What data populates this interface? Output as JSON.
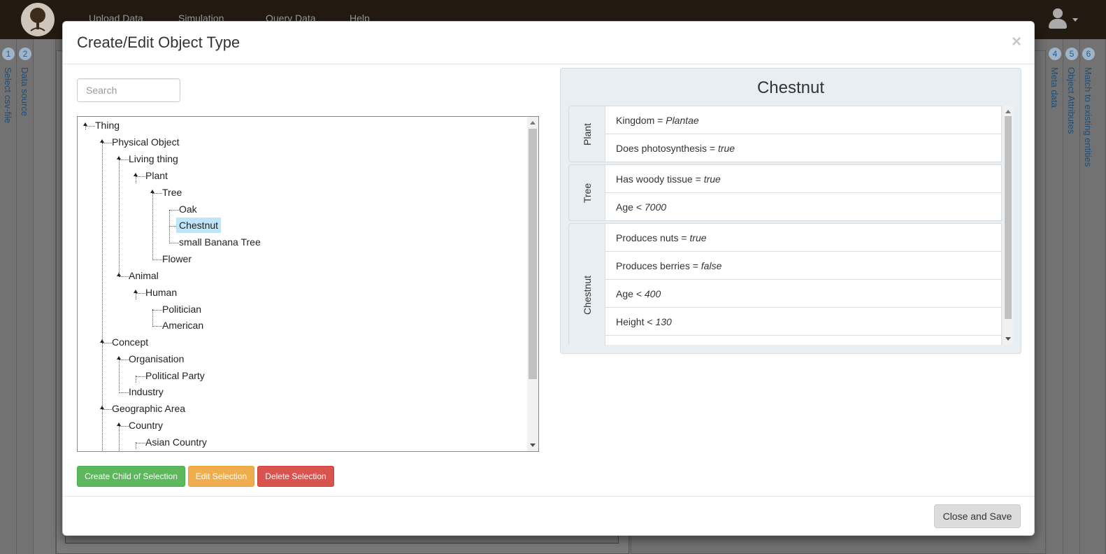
{
  "navbar": {
    "items": [
      "Upload Data",
      "Simulation",
      "Query Data",
      "Help"
    ]
  },
  "steps_left": [
    {
      "num": "1",
      "label": "Select csv-file"
    },
    {
      "num": "2",
      "label": "Data source"
    }
  ],
  "steps_right": [
    {
      "num": "4",
      "label": "Meta data"
    },
    {
      "num": "5",
      "label": "Object Attributes"
    },
    {
      "num": "6",
      "label": "Match to existing entities"
    }
  ],
  "modal": {
    "title": "Create/Edit Object Type",
    "close_symbol": "×",
    "search_placeholder": "Search",
    "tree": [
      "Thing",
      "Physical Object",
      "Living thing",
      "Plant",
      "Tree",
      "Oak",
      "Chestnut",
      "small Banana Tree",
      "Flower",
      "Animal",
      "Human",
      "Politician",
      "American",
      "Concept",
      "Organisation",
      "Political Party",
      "Industry",
      "Geographic Area",
      "Country",
      "Asian Country"
    ],
    "selected_node": "Chestnut",
    "buttons": {
      "create_child": "Create Child of Selection",
      "edit": "Edit Selection",
      "delete": "Delete Selection"
    },
    "detail": {
      "title": "Chestnut",
      "groups": [
        {
          "label": "Plant",
          "rows": [
            {
              "name": "Kingdom",
              "op": "=",
              "value": "Plantae"
            },
            {
              "name": "Does photosynthesis",
              "op": "=",
              "value": "true"
            }
          ]
        },
        {
          "label": "Tree",
          "rows": [
            {
              "name": "Has woody tissue",
              "op": "=",
              "value": "true"
            },
            {
              "name": "Age",
              "op": "<",
              "value": "7000"
            }
          ]
        },
        {
          "label": "Chestnut",
          "rows": [
            {
              "name": "Produces nuts",
              "op": "=",
              "value": "true"
            },
            {
              "name": "Produces berries",
              "op": "=",
              "value": "false"
            },
            {
              "name": "Age",
              "op": "<",
              "value": "400"
            },
            {
              "name": "Height",
              "op": "<",
              "value": "130"
            }
          ]
        }
      ]
    },
    "footer_button": "Close and Save"
  }
}
